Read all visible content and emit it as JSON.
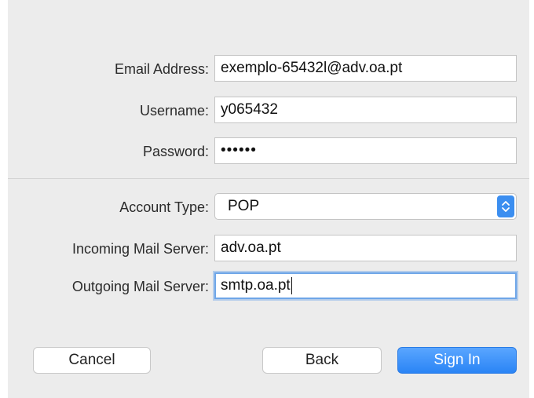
{
  "form": {
    "email": {
      "label": "Email Address:",
      "value": "exemplo-65432l@adv.oa.pt"
    },
    "username": {
      "label": "Username:",
      "value": "y065432"
    },
    "password": {
      "label": "Password:",
      "value": "••••••"
    },
    "account_type": {
      "label": "Account Type:",
      "value": "POP"
    },
    "incoming_server": {
      "label": "Incoming Mail Server:",
      "value": "adv.oa.pt"
    },
    "outgoing_server": {
      "label": "Outgoing Mail Server:",
      "value": "smtp.oa.pt"
    }
  },
  "buttons": {
    "cancel": "Cancel",
    "back": "Back",
    "sign_in": "Sign In"
  },
  "colors": {
    "accent": "#3b8ef0",
    "panel_background": "#ececec"
  }
}
